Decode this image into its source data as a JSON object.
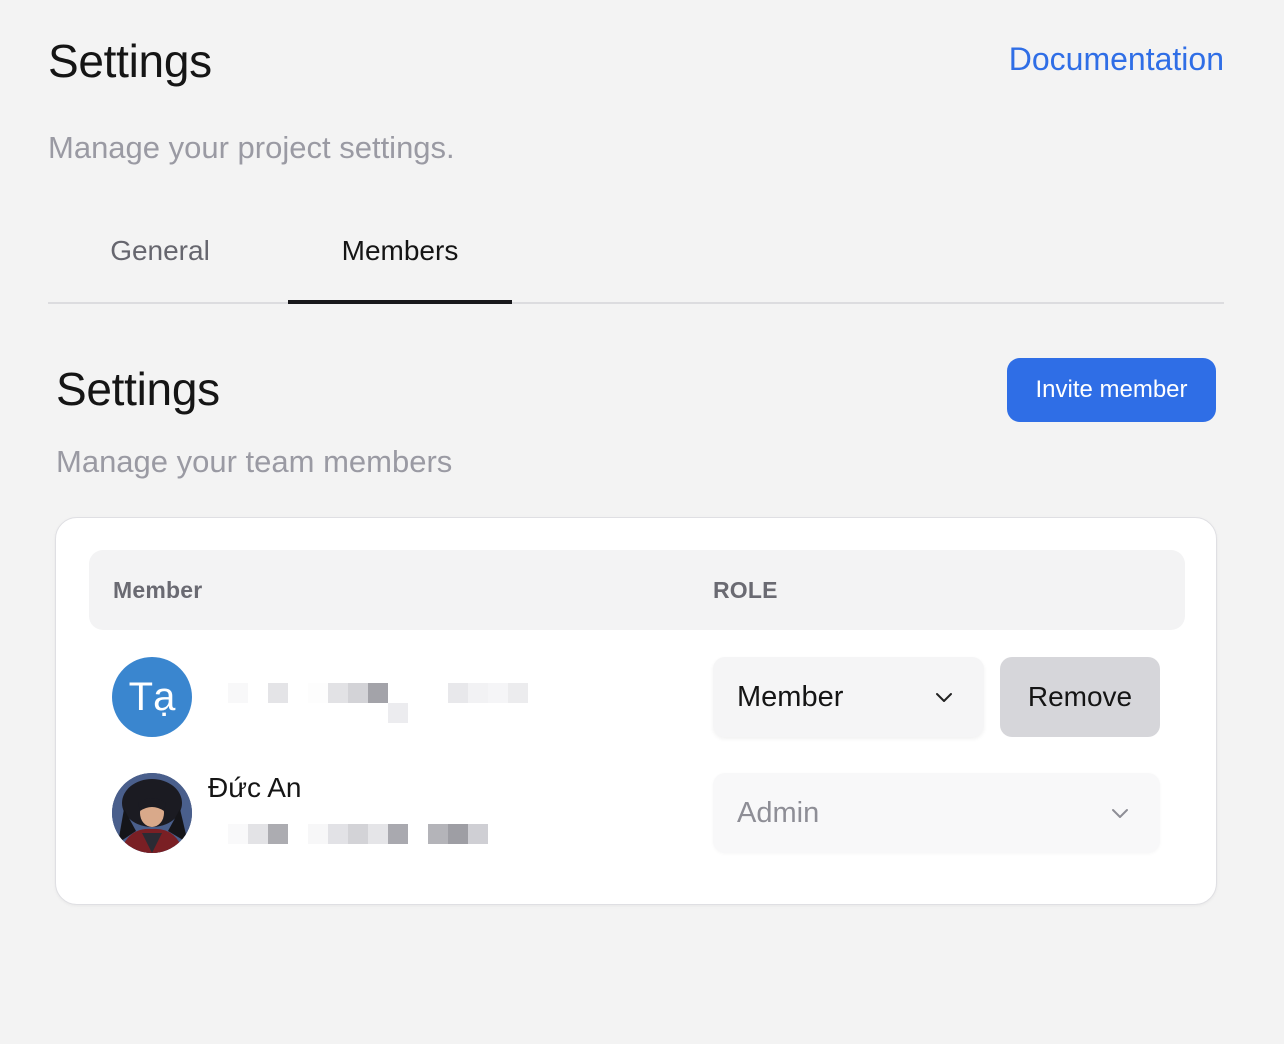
{
  "header": {
    "title": "Settings",
    "documentation_link": "Documentation",
    "subtitle": "Manage your project settings."
  },
  "tabs": [
    {
      "label": "General",
      "active": false
    },
    {
      "label": "Members",
      "active": true
    }
  ],
  "members_section": {
    "title": "Settings",
    "subtitle": "Manage your team members",
    "invite_button": "Invite member"
  },
  "table": {
    "columns": [
      "Member",
      "ROLE"
    ],
    "rows": [
      {
        "avatar_initials": "Tạ",
        "avatar_type": "initials",
        "name": "",
        "email_redacted": true,
        "role": "Member",
        "role_editable": true,
        "action": "Remove"
      },
      {
        "avatar_type": "photo",
        "name": "Đức An",
        "email_redacted": true,
        "role": "Admin",
        "role_editable": false
      }
    ]
  },
  "colors": {
    "accent": "#2f6ee6",
    "background": "#f3f3f3",
    "card": "#ffffff",
    "avatar_initials_bg": "#3a86cf",
    "remove_button_bg": "#d6d6da"
  },
  "icons": {
    "role_dropdown": "chevron-down-icon"
  }
}
